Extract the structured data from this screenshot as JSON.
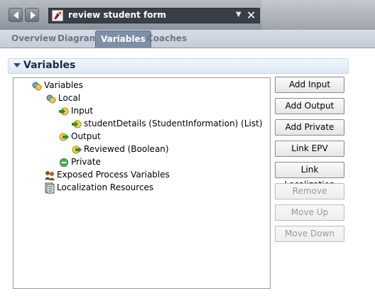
{
  "window": {
    "title": "review student form",
    "dropdown_icon": "caret-down-icon",
    "close_icon": "close-icon"
  },
  "tabs": [
    {
      "label": "Overview",
      "active": false
    },
    {
      "label": "Diagram",
      "active": false
    },
    {
      "label": "Variables",
      "active": true
    },
    {
      "label": "Coaches",
      "active": false
    }
  ],
  "section": {
    "title": "Variables",
    "toggle_icon": "triangle-down-icon"
  },
  "tree": [
    {
      "label": "Variables",
      "icon": "variables-icon",
      "level": 0
    },
    {
      "label": "Local",
      "icon": "variables-icon",
      "level": 1
    },
    {
      "label": "Input",
      "icon": "input-arrow-icon",
      "level": 2
    },
    {
      "label": "studentDetails (StudentInformation) (List)",
      "icon": "input-arrow-icon",
      "level": 3
    },
    {
      "label": "Output",
      "icon": "output-arrow-icon",
      "level": 2
    },
    {
      "label": "Reviewed (Boolean)",
      "icon": "output-arrow-icon",
      "level": 3
    },
    {
      "label": "Private",
      "icon": "private-icon",
      "level": 2
    },
    {
      "label": "Exposed Process Variables",
      "icon": "exposed-variables-icon",
      "level": 1
    },
    {
      "label": "Localization Resources",
      "icon": "localization-icon",
      "level": 1
    }
  ],
  "buttons": [
    {
      "label": "Add Input",
      "enabled": true
    },
    {
      "label": "Add Output",
      "enabled": true
    },
    {
      "label": "Add Private",
      "enabled": true
    },
    {
      "label": "Link EPV",
      "enabled": true
    },
    {
      "label": "Link Localization",
      "enabled": true
    },
    {
      "label": "Remove",
      "enabled": false
    },
    {
      "label": "Move Up",
      "enabled": false
    },
    {
      "label": "Move Down",
      "enabled": false
    }
  ],
  "colors": {
    "toolbar": "#a4a9b1",
    "active_tab": "#7e8fa6",
    "section_title": "#1d2a3d",
    "disabled_text": "#9a9a9a"
  }
}
